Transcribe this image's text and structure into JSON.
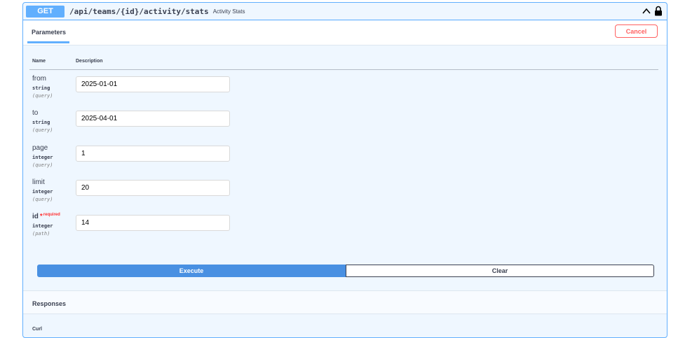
{
  "operation": {
    "method": "GET",
    "path": "/api/teams/{id}/activity/stats",
    "summary": "Activity Stats"
  },
  "tabs": {
    "parameters_label": "Parameters",
    "cancel_label": "Cancel"
  },
  "columns": {
    "name": "Name",
    "description": "Description"
  },
  "params": [
    {
      "name": "from",
      "type": "string",
      "in": "(query)",
      "value": "2025-01-01"
    },
    {
      "name": "to",
      "type": "string",
      "in": "(query)",
      "value": "2025-04-01"
    },
    {
      "name": "page",
      "type": "integer",
      "in": "(query)",
      "value": "1"
    },
    {
      "name": "limit",
      "type": "integer",
      "in": "(query)",
      "value": "20"
    },
    {
      "name": "id",
      "required_mark": "*",
      "required_text": "required",
      "type": "integer",
      "in": "(path)",
      "value": "14"
    }
  ],
  "actions": {
    "execute_label": "Execute",
    "clear_label": "Clear"
  },
  "responses": {
    "title": "Responses",
    "curl_label": "Curl"
  },
  "colors": {
    "get_blue": "#61affe",
    "execute_blue": "#4990e2",
    "cancel_red": "#ff6060"
  }
}
